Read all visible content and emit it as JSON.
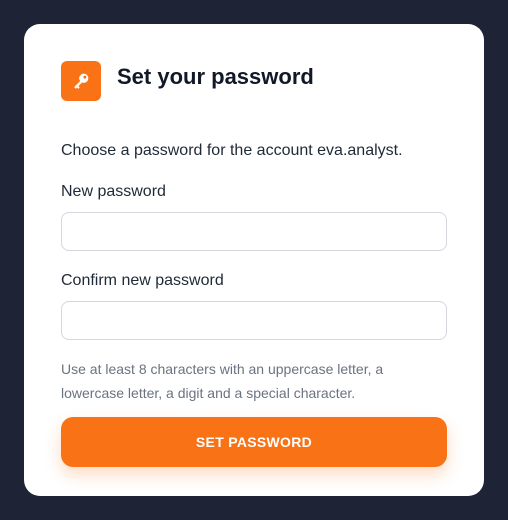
{
  "colors": {
    "background": "#1e2435",
    "card": "#ffffff",
    "accent": "#f97316",
    "title": "#111827",
    "hint": "#6b7280"
  },
  "header": {
    "icon": "key-icon",
    "title": "Set your password"
  },
  "intro": "Choose a password for the account eva.analyst.",
  "fields": {
    "new_password": {
      "label": "New password",
      "value": ""
    },
    "confirm_password": {
      "label": "Confirm new password",
      "value": ""
    }
  },
  "hint": "Use at least 8 characters with an uppercase letter, a lowercase letter, a digit and a special character.",
  "submit_label": "SET PASSWORD"
}
